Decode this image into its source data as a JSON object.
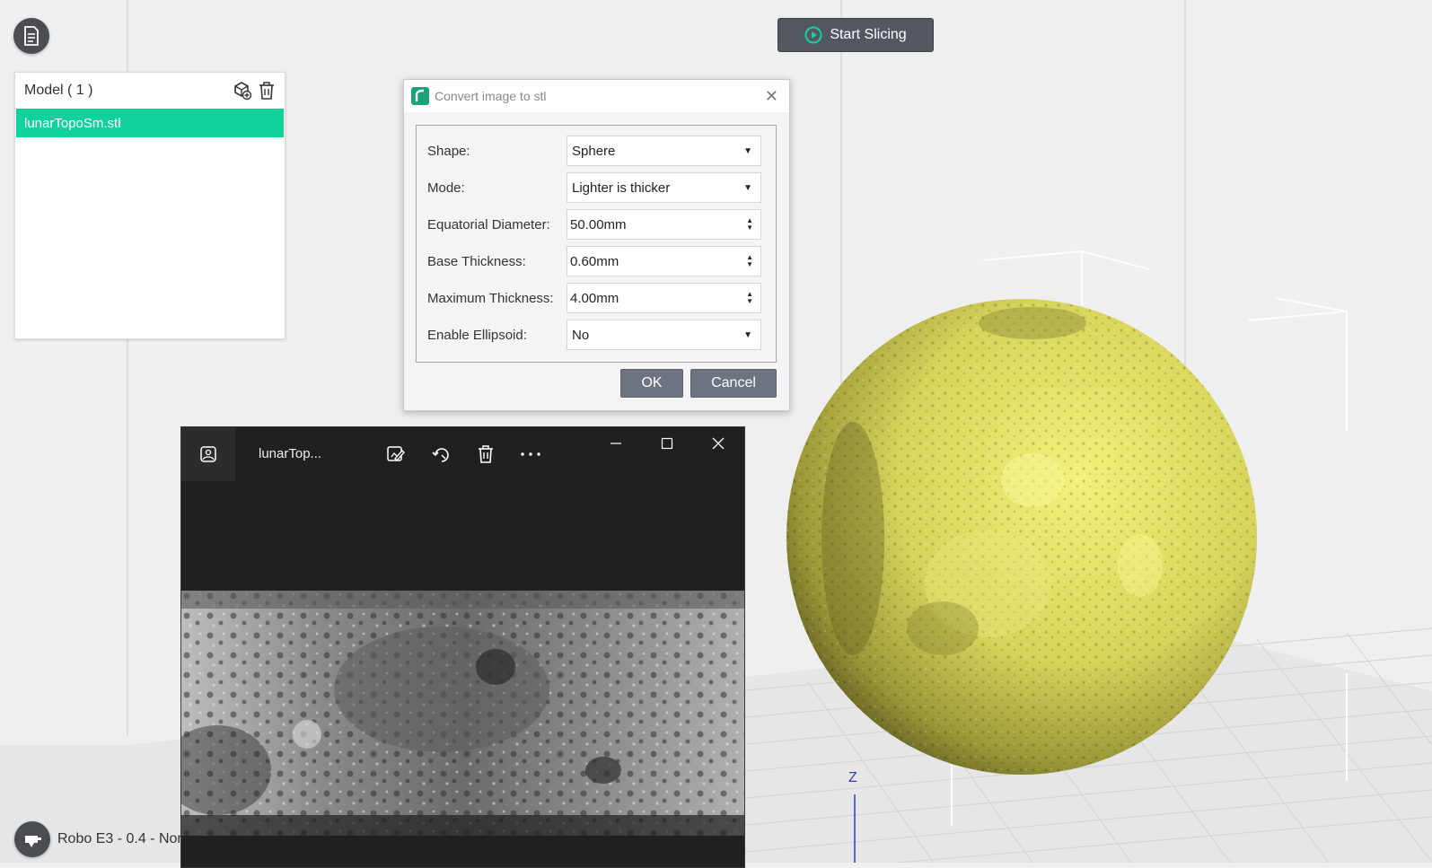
{
  "toolbar": {
    "start_slicing_label": "Start Slicing"
  },
  "model_panel": {
    "title": "Model ( 1 )",
    "items": [
      {
        "label": "lunarTopoSm.stl",
        "selected": true
      }
    ]
  },
  "dialog": {
    "title": "Convert image to stl",
    "fields": [
      {
        "label": "Shape:",
        "value": "Sphere",
        "control": "select"
      },
      {
        "label": "Mode:",
        "value": "Lighter is thicker",
        "control": "select"
      },
      {
        "label": "Equatorial Diameter:",
        "value": "50.00mm",
        "control": "spin"
      },
      {
        "label": "Base Thickness:",
        "value": "0.60mm",
        "control": "spin"
      },
      {
        "label": "Maximum Thickness:",
        "value": "4.00mm",
        "control": "spin"
      },
      {
        "label": "Enable Ellipsoid:",
        "value": "No",
        "control": "select"
      }
    ],
    "ok_label": "OK",
    "cancel_label": "Cancel"
  },
  "viewer": {
    "title": "lunarTop..."
  },
  "viewport": {
    "axis_label": "Z",
    "model_color": "#e6e36a"
  },
  "printer": {
    "label": "Robo E3 - 0.4 - Nor"
  },
  "colors": {
    "accent": "#0fd39b",
    "button": "#6d7380"
  }
}
